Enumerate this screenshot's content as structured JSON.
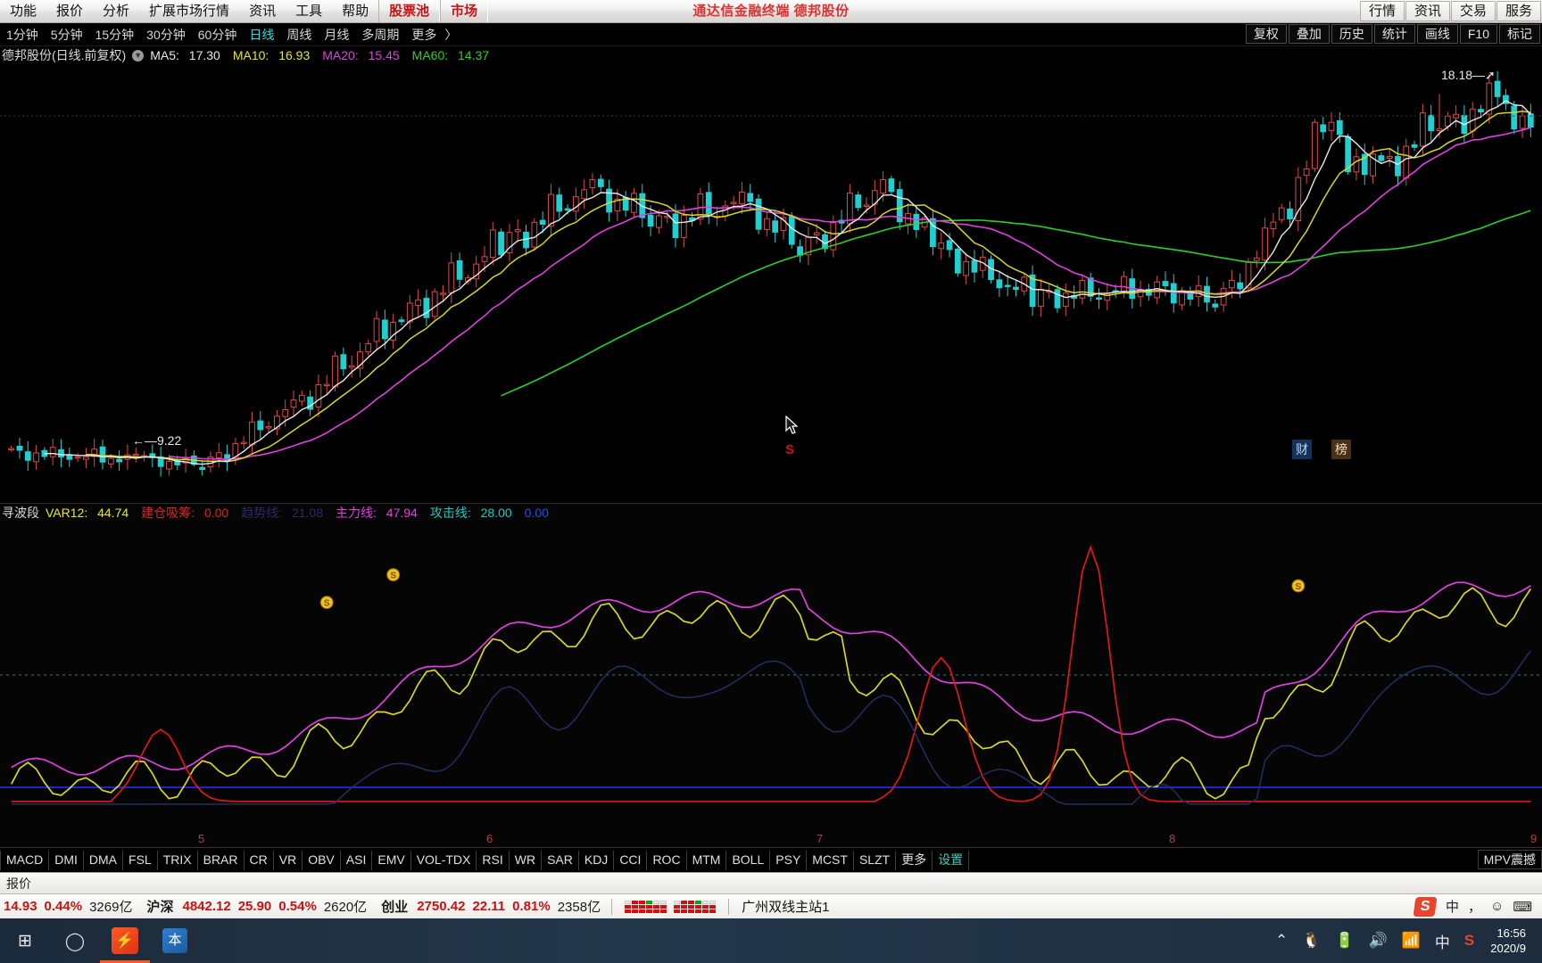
{
  "window": {
    "title": "通达信金融终端  德邦股份"
  },
  "menu": {
    "items": [
      {
        "label": "功能",
        "style": "normal"
      },
      {
        "label": "报价",
        "style": "normal"
      },
      {
        "label": "分析",
        "style": "normal"
      },
      {
        "label": "扩展市场行情",
        "style": "normal"
      },
      {
        "label": "资讯",
        "style": "normal"
      },
      {
        "label": "工具",
        "style": "normal"
      },
      {
        "label": "帮助",
        "style": "normal"
      },
      {
        "label": "股票池",
        "style": "red"
      },
      {
        "label": "市场",
        "style": "red"
      }
    ],
    "right_buttons": [
      "行情",
      "资讯",
      "交易",
      "服务"
    ]
  },
  "period_bar": {
    "periods": [
      {
        "label": "1分钟",
        "active": false
      },
      {
        "label": "5分钟",
        "active": false
      },
      {
        "label": "15分钟",
        "active": false
      },
      {
        "label": "30分钟",
        "active": false
      },
      {
        "label": "60分钟",
        "active": false
      },
      {
        "label": "日线",
        "active": true
      },
      {
        "label": "周线",
        "active": false
      },
      {
        "label": "月线",
        "active": false
      },
      {
        "label": "多周期",
        "active": false
      },
      {
        "label": "更多",
        "active": false
      }
    ],
    "chevron": "〉",
    "right_buttons": [
      "复权",
      "叠加",
      "历史",
      "统计",
      "画线",
      "F10",
      "标记"
    ]
  },
  "chart": {
    "legend": {
      "title": "德邦股份(日线.前复权)",
      "badge": "▼",
      "ma5_label": "MA5:",
      "ma5_value": "17.30",
      "ma10_label": "MA10:",
      "ma10_value": "16.93",
      "ma20_label": "MA20:",
      "ma20_value": "15.45",
      "ma60_label": "MA60:",
      "ma60_value": "14.37"
    },
    "high_label": "18.18",
    "low_label": "9.22",
    "high_arrow": "—➚",
    "low_arrow": "←—",
    "watermark_s": "S",
    "watermark_cai": "财",
    "watermark_bang": "榜",
    "axis_months": [
      "5",
      "6",
      "7",
      "8",
      "9"
    ]
  },
  "indicator": {
    "legend": {
      "name": "寻波段",
      "var12_label": "VAR12:",
      "var12_value": "44.74",
      "jiancang_label": "建仓吸筹:",
      "jiancang_value": "0.00",
      "qushi_label": "趋势线:",
      "qushi_value": "21.08",
      "zhuli_label": "主力线:",
      "zhuli_value": "47.94",
      "gongji_label": "攻击线:",
      "gongji_value": "28.00",
      "extra_value": "0.00"
    },
    "tabs": [
      "MACD",
      "DMI",
      "DMA",
      "FSL",
      "TRIX",
      "BRAR",
      "CR",
      "VR",
      "OBV",
      "ASI",
      "EMV",
      "VOL-TDX",
      "RSI",
      "WR",
      "SAR",
      "KDJ",
      "CCI",
      "ROC",
      "MTM",
      "BOLL",
      "PSY",
      "MCST",
      "SLZT",
      "更多"
    ],
    "settings_label": "设置",
    "mpv_label": "MPV震撼"
  },
  "statusbar": {
    "quote_label": "报价",
    "indices": [
      {
        "name": "",
        "value": "",
        "change": "14.93",
        "pct": "0.44%",
        "volume": "3269亿"
      },
      {
        "name": "沪深",
        "value": "4842.12",
        "change": "25.90",
        "pct": "0.54%",
        "volume": "2620亿"
      },
      {
        "name": "创业",
        "value": "2750.42",
        "change": "22.11",
        "pct": "0.81%",
        "volume": "2358亿"
      }
    ],
    "server": "广州双线主站1",
    "ime_label": "中",
    "sogou_label": "S"
  },
  "taskbar": {
    "time": "16:56",
    "date": "2020/9",
    "ime": "中",
    "tray_icons": [
      "chevron-up-icon",
      "qq-icon",
      "battery-icon",
      "volume-icon",
      "wifi-icon"
    ]
  },
  "colors": {
    "up": "#e04040",
    "down": "#20d0d0",
    "ma5": "#e8e8e8",
    "ma10": "#e8e81e",
    "ma20": "#e040e0",
    "ma60": "#28d228",
    "accent_red": "#d01010",
    "accent_teal": "#22e0e0"
  },
  "chart_data": {
    "type": "candlestick",
    "title": "德邦股份(日线.前复权)",
    "ylim": [
      8.6,
      18.9
    ],
    "high": 18.18,
    "low": 9.22,
    "ma_series": [
      {
        "name": "MA5",
        "value": 17.3,
        "color": "#e8e8e8"
      },
      {
        "name": "MA10",
        "value": 16.93,
        "color": "#e8e81e"
      },
      {
        "name": "MA20",
        "value": 15.45,
        "color": "#e040e0"
      },
      {
        "name": "MA60",
        "value": 14.37,
        "color": "#28d228"
      }
    ],
    "month_ticks": [
      "5",
      "6",
      "7",
      "8",
      "9"
    ]
  }
}
